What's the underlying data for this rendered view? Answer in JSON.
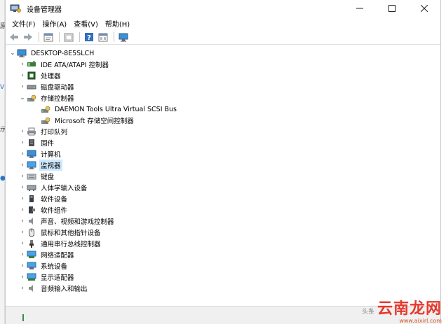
{
  "window": {
    "title": "设备管理器",
    "controls": {
      "minimize": "—",
      "maximize": "☐",
      "close": "✕"
    }
  },
  "menubar": {
    "items": [
      "文件(F)",
      "操作(A)",
      "查看(V)",
      "帮助(H)"
    ]
  },
  "toolbar": {
    "buttons": [
      "back-icon",
      "forward-icon",
      "properties-icon",
      "update-driver-icon",
      "help-icon",
      "view-icon",
      "monitor-icon"
    ]
  },
  "tree": {
    "root": "DESKTOP-8E5SLCH",
    "items": [
      {
        "label": "IDE ATA/ATAPI 控制器",
        "icon": "ide-icon",
        "expanded": false
      },
      {
        "label": "处理器",
        "icon": "processor-icon",
        "expanded": false
      },
      {
        "label": "磁盘驱动器",
        "icon": "disk-drive-icon",
        "expanded": false
      },
      {
        "label": "存储控制器",
        "icon": "storage-controller-icon",
        "expanded": true,
        "children": [
          {
            "label": "DAEMON Tools Ultra Virtual SCSI Bus",
            "icon": "storage-controller-icon"
          },
          {
            "label": "Microsoft 存储空间控制器",
            "icon": "storage-controller-icon"
          }
        ]
      },
      {
        "label": "打印队列",
        "icon": "printer-icon",
        "expanded": false
      },
      {
        "label": "固件",
        "icon": "firmware-icon",
        "expanded": false
      },
      {
        "label": "计算机",
        "icon": "computer-icon",
        "expanded": false
      },
      {
        "label": "监视器",
        "icon": "monitor-icon",
        "expanded": false,
        "selected": true
      },
      {
        "label": "键盘",
        "icon": "keyboard-icon",
        "expanded": false
      },
      {
        "label": "人体学输入设备",
        "icon": "hid-icon",
        "expanded": false
      },
      {
        "label": "软件设备",
        "icon": "software-device-icon",
        "expanded": false
      },
      {
        "label": "软件组件",
        "icon": "software-component-icon",
        "expanded": false
      },
      {
        "label": "声音、视频和游戏控制器",
        "icon": "sound-icon",
        "expanded": false
      },
      {
        "label": "鼠标和其他指针设备",
        "icon": "mouse-icon",
        "expanded": false
      },
      {
        "label": "通用串行总线控制器",
        "icon": "usb-icon",
        "expanded": false
      },
      {
        "label": "网络适配器",
        "icon": "network-icon",
        "expanded": false
      },
      {
        "label": "系统设备",
        "icon": "system-device-icon",
        "expanded": false
      },
      {
        "label": "显示适配器",
        "icon": "display-adapter-icon",
        "expanded": false
      },
      {
        "label": "音频输入和输出",
        "icon": "audio-io-icon",
        "expanded": false
      }
    ]
  },
  "watermark": {
    "prefix": "头条",
    "main": "云南龙网",
    "url": "www.aixirl.com"
  },
  "colors": {
    "selection": "#cce8ff",
    "watermark": "#e53a2e"
  }
}
